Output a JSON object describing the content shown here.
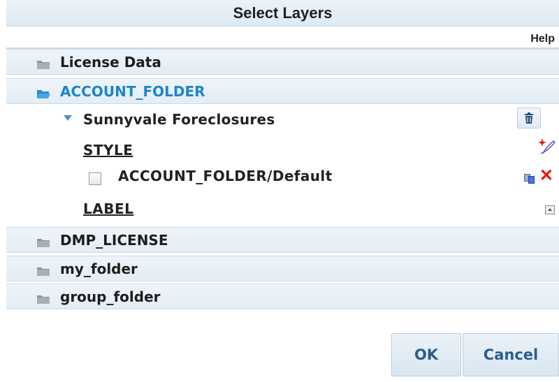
{
  "dialog": {
    "title": "Select Layers",
    "help_label": "Help"
  },
  "folders": [
    {
      "name": "License Data",
      "expanded": false
    },
    {
      "name": "ACCOUNT_FOLDER",
      "expanded": true
    },
    {
      "name": "DMP_LICENSE",
      "expanded": false
    },
    {
      "name": "my_folder",
      "expanded": false
    },
    {
      "name": "group_folder",
      "expanded": false
    }
  ],
  "layer": {
    "name": "Sunnyvale Foreclosures",
    "style_label": "STYLE",
    "style_item": "ACCOUNT_FOLDER/Default",
    "style_item_checked": false,
    "label_label": "LABEL"
  },
  "buttons": {
    "ok": "OK",
    "cancel": "Cancel"
  },
  "colors": {
    "accent_open_folder": "#1d86c9",
    "delete_red": "#ee1111",
    "button_text": "#2b5d8f"
  },
  "icons": {
    "folder": "folder-icon",
    "folder_open": "folder-open-icon",
    "trash": "trash-icon",
    "style_edit": "style-edit-icon",
    "copy": "copy-icon",
    "delete": "delete-icon",
    "label": "label-icon"
  }
}
